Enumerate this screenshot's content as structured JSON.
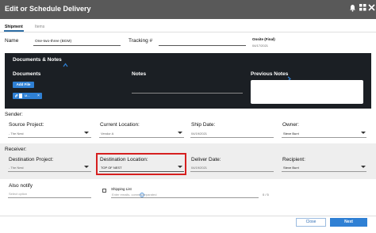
{
  "window": {
    "title": "Edit or Schedule Delivery",
    "icons": [
      "bell-icon",
      "grid-icon",
      "close-icon"
    ]
  },
  "tabs": [
    {
      "label": "Shipment",
      "active": true
    },
    {
      "label": "Items",
      "active": false
    }
  ],
  "header": {
    "name_label": "Name",
    "name_value": "One-two-three (BGM)",
    "tracking_label": "Tracking #",
    "tracking_value": "",
    "status_label": "Onsite (Final)",
    "status_date": "04/17/2021"
  },
  "documents": {
    "section_title": "Documents & Notes",
    "col_documents": "Documents",
    "col_notes": "Notes",
    "col_previous_notes": "Previous Notes",
    "add_file_label": "Add File",
    "file_chip_label": "M..."
  },
  "sender": {
    "section_label": "Sender:",
    "source_project_label": "Source Project:",
    "source_project_value": "- The Nest",
    "current_location_label": "Current Location:",
    "current_location_value": "Vendor A",
    "ship_date_label": "Ship Date:",
    "ship_date_value": "04/19/2021",
    "owner_label": "Owner:",
    "owner_value": "Steve Burri"
  },
  "receiver": {
    "section_label": "Receiver:",
    "destination_project_label": "Destination Project:",
    "destination_project_value": "- The Nest",
    "destination_location_label": "Destination Location:",
    "destination_location_value": "TOP OF NEST",
    "deliver_date_label": "Deliver Date:",
    "deliver_date_value": "04/19/2021",
    "recipient_label": "Recipient:",
    "recipient_value": "Steve Burri"
  },
  "notify": {
    "also_notify_label": "Also notify",
    "also_notify_placeholder": "Select option",
    "shipping_list_label": "Shipping List",
    "shipping_list_placeholder": "Enter emails, comma separated",
    "counter": "0 / 5"
  },
  "footer": {
    "close_label": "Close",
    "next_label": "Next"
  },
  "colors": {
    "titlebar": "#595959",
    "accent": "#2f80d4",
    "highlight": "#d62020",
    "docs_panel": "#1b1f24"
  }
}
